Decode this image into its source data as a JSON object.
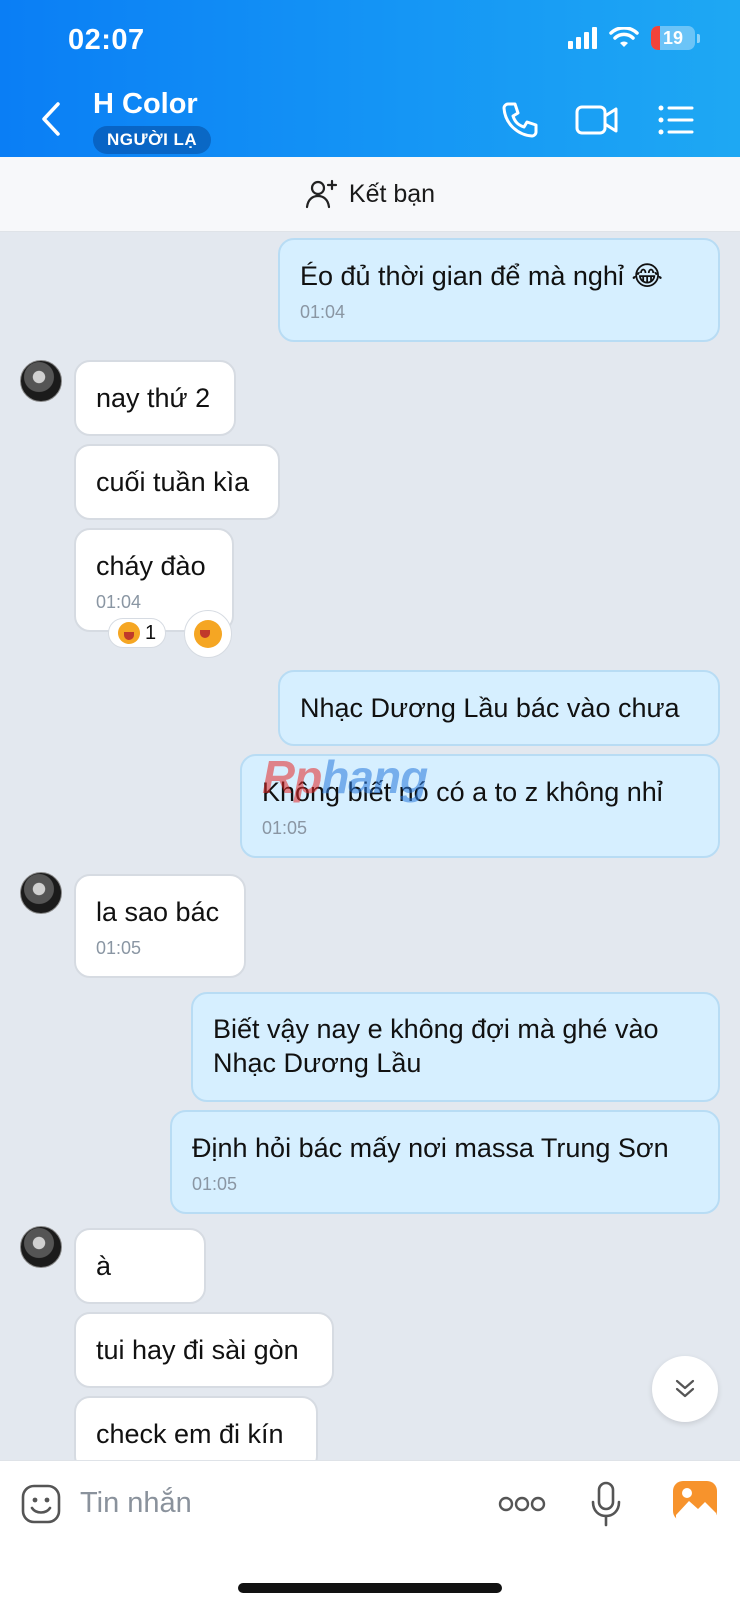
{
  "status_bar": {
    "time": "02:07",
    "battery": "19"
  },
  "header": {
    "title": "H Color",
    "badge": "NGƯỜI LẠ"
  },
  "friend_bar": {
    "label": "Kết bạn"
  },
  "messages": {
    "m1": {
      "text": "Éo đủ thời gian để mà nghỉ 😂",
      "time": "01:04"
    },
    "m2": {
      "text": "nay thứ 2"
    },
    "m3": {
      "text": "cuối tuần kìa"
    },
    "m4": {
      "text": "cháy đào",
      "time": "01:04",
      "reaction_count": "1"
    },
    "m5": {
      "text": "Nhạc Dương Lầu bác vào chưa"
    },
    "m6": {
      "text": "Không biết nó có a to z không nhỉ",
      "time": "01:05"
    },
    "m7": {
      "text": "la sao bác",
      "time": "01:05"
    },
    "m8": {
      "line1": "Biết vậy nay e không đợi mà ghé vào",
      "line2": "Nhạc Dương Lầu"
    },
    "m9": {
      "text": "Định hỏi bác mấy nơi massa Trung Sơn",
      "time": "01:05"
    },
    "m10": {
      "text": "à"
    },
    "m11": {
      "text": "tui hay đi sài gòn"
    },
    "m12": {
      "text": "check em đi kín"
    }
  },
  "watermark": {
    "part1": "Rp",
    "part2": "hang"
  },
  "input": {
    "placeholder": "Tin nhắn",
    "value": ""
  },
  "colors": {
    "header_start": "#0a7ef5",
    "header_end": "#1ea8f3",
    "outgoing_bubble": "#d6efff",
    "incoming_bubble": "#ffffff",
    "chat_bg": "#e3e8ef",
    "image_button": "#f7932c"
  },
  "icons": [
    "back-icon",
    "phone-icon",
    "video-icon",
    "menu-icon",
    "add-friend-icon",
    "scroll-down-icon",
    "emoji-icon",
    "more-icon",
    "mic-icon",
    "image-icon"
  ]
}
